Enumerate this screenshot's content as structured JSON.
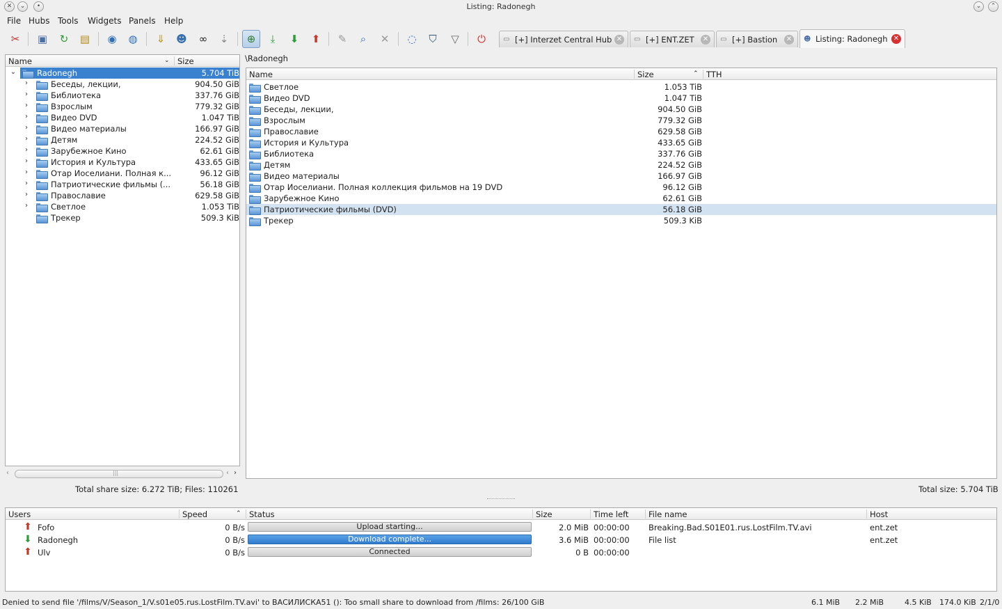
{
  "window": {
    "title": "Listing: Radonegh"
  },
  "menu": [
    "File",
    "Hubs",
    "Tools",
    "Widgets",
    "Panels",
    "Help"
  ],
  "tabs": [
    {
      "label": "[+] Interzet Central Hub",
      "icon": "hub-icon"
    },
    {
      "label": "[+] ENT.ZET",
      "icon": "hub-icon"
    },
    {
      "label": "[+] Bastion",
      "icon": "hub-icon"
    },
    {
      "label": "Listing: Radonegh",
      "icon": "user-icon",
      "selected": true
    }
  ],
  "tree": {
    "headers": {
      "name": "Name",
      "size": "Size"
    },
    "root": {
      "name": "Radonegh",
      "size": "5.704 TiB"
    },
    "items": [
      {
        "name": "Беседы, лекции,",
        "size": "904.50 GiB"
      },
      {
        "name": "Библиотека",
        "size": "337.76 GiB"
      },
      {
        "name": "Взрослым",
        "size": "779.32 GiB"
      },
      {
        "name": "Видео DVD",
        "size": "1.047 TiB"
      },
      {
        "name": "Видео материалы",
        "size": "166.97 GiB"
      },
      {
        "name": "Детям",
        "size": "224.52 GiB"
      },
      {
        "name": "Зарубежное Кино",
        "size": "62.61 GiB"
      },
      {
        "name": "История и Культура",
        "size": "433.65 GiB"
      },
      {
        "name": "Отар Иоселиани. Полная к...",
        "size": "96.12 GiB"
      },
      {
        "name": "Патриотические фильмы (...",
        "size": "56.18 GiB"
      },
      {
        "name": "Православие",
        "size": "629.58 GiB"
      },
      {
        "name": "Светлое",
        "size": "1.053 TiB"
      },
      {
        "name": "Трекер",
        "size": "509.3 KiB",
        "leaf": true
      }
    ],
    "footer": "Total share size: 6.272 TiB;  Files: 110261"
  },
  "listing": {
    "path": "\\Radonegh",
    "headers": {
      "name": "Name",
      "size": "Size",
      "tth": "TTH"
    },
    "rows": [
      {
        "name": "Светлое",
        "size": "1.053 TiB"
      },
      {
        "name": "Видео DVD",
        "size": "1.047 TiB"
      },
      {
        "name": "Беседы, лекции,",
        "size": "904.50 GiB"
      },
      {
        "name": "Взрослым",
        "size": "779.32 GiB"
      },
      {
        "name": "Православие",
        "size": "629.58 GiB"
      },
      {
        "name": "История и Культура",
        "size": "433.65 GiB"
      },
      {
        "name": "Библиотека",
        "size": "337.76 GiB"
      },
      {
        "name": "Детям",
        "size": "224.52 GiB"
      },
      {
        "name": "Видео материалы",
        "size": "166.97 GiB"
      },
      {
        "name": "Отар Иоселиани. Полная коллекция фильмов на 19 DVD",
        "size": "96.12 GiB"
      },
      {
        "name": "Зарубежное Кино",
        "size": "62.61 GiB"
      },
      {
        "name": "Патриотические фильмы (DVD)",
        "size": "56.18 GiB",
        "selected": true
      },
      {
        "name": "Трекер",
        "size": "509.3 KiB"
      }
    ],
    "footer": "Total size: 5.704 TiB"
  },
  "transfers": {
    "headers": {
      "users": "Users",
      "speed": "Speed",
      "status": "Status",
      "size": "Size",
      "time_left": "Time left",
      "file_name": "File name",
      "host": "Host"
    },
    "rows": [
      {
        "user": "Fofo",
        "dir": "upload",
        "speed": "0 B/s",
        "status": "Upload starting...",
        "progress": 0,
        "size": "2.0 MiB",
        "time_left": "00:00:00",
        "file": "Breaking.Bad.S01E01.rus.LostFilm.TV.avi",
        "host": "ent.zet"
      },
      {
        "user": "Radonegh",
        "dir": "download",
        "speed": "0 B/s",
        "status": "Download complete...",
        "progress": 100,
        "size": "3.6 MiB",
        "time_left": "00:00:00",
        "file": "File list",
        "host": "ent.zet"
      },
      {
        "user": "Ulv",
        "dir": "upload",
        "speed": "0 B/s",
        "status": "Connected",
        "progress": 0,
        "size": "0 B",
        "time_left": "00:00:00",
        "file": "",
        "host": ""
      }
    ]
  },
  "statusbar": {
    "message": "Denied to send file '/films/V/Season_1/V.s01e05.rus.LostFilm.TV.avi' to ВАСИЛИСКА51 (): Too small share to download from /films: 26/100 GiB",
    "dl_total": "6.1 MiB",
    "ul_total": "2.2 MiB",
    "dl_speed": "4.5 KiB",
    "ul_speed": "174.0 KiB",
    "slots": "2/1/0"
  },
  "colors": {
    "selection": "#3a82cf",
    "row_highlight": "#d3e2f1",
    "close_active": "#d63030"
  }
}
